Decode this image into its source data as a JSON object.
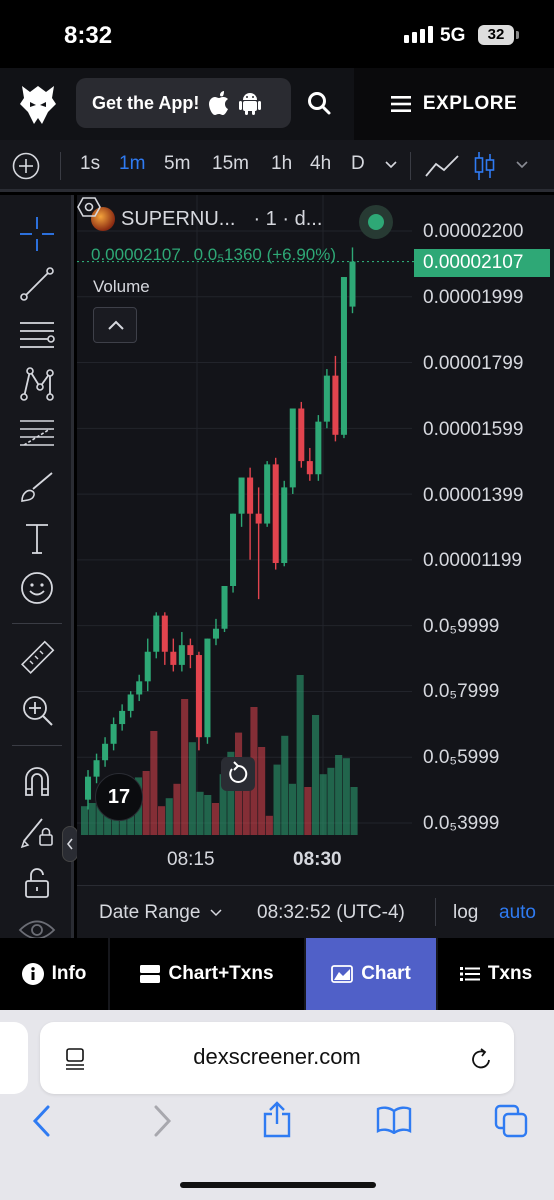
{
  "status": {
    "time": "8:32",
    "network": "5G",
    "battery": "32"
  },
  "header": {
    "get_app_label": "Get the App!",
    "explore_label": "EXPLORE"
  },
  "toolbar": {
    "timeframes": [
      {
        "label": "1s",
        "active": false
      },
      {
        "label": "1m",
        "active": true
      },
      {
        "label": "5m",
        "active": false
      },
      {
        "label": "15m",
        "active": false
      },
      {
        "label": "1h",
        "active": false
      },
      {
        "label": "4h",
        "active": false
      },
      {
        "label": "D",
        "active": false
      }
    ]
  },
  "chart": {
    "symbol": "SUPERNU...",
    "interval": "· 1 · d...",
    "last_price": "0.00002107",
    "change": "0.0₅1360 (+6.90%)",
    "volume_label": "Volume",
    "price_labels": [
      "0.00002200",
      "0.00001999",
      "0.00001799",
      "0.00001599",
      "0.00001399",
      "0.00001199",
      "0.0₅9999",
      "0.0₅7999",
      "0.0₅5999",
      "0.0₅3999"
    ],
    "price_tag": "0.00002107",
    "time_labels": [
      "08:15",
      "08:30"
    ],
    "tv_logo": "17",
    "colors": {
      "up": "#2ea876",
      "down": "#e2444e",
      "background": "#131419"
    }
  },
  "chart_data": {
    "type": "candlestick",
    "y_range": [
      3.99e-06,
      2.2e-05
    ],
    "up_color": "#2ea876",
    "down_color": "#e2444e",
    "candles": [
      {
        "o": 4.7e-06,
        "h": 5.6e-06,
        "l": 4.4e-06,
        "c": 5.4e-06
      },
      {
        "o": 5.4e-06,
        "h": 6.1e-06,
        "l": 5.2e-06,
        "c": 5.9e-06
      },
      {
        "o": 5.9e-06,
        "h": 6.6e-06,
        "l": 5.7e-06,
        "c": 6.4e-06
      },
      {
        "o": 6.4e-06,
        "h": 7.2e-06,
        "l": 6.2e-06,
        "c": 7e-06
      },
      {
        "o": 7e-06,
        "h": 7.6e-06,
        "l": 6.8e-06,
        "c": 7.4e-06
      },
      {
        "o": 7.4e-06,
        "h": 8e-06,
        "l": 7.2e-06,
        "c": 7.9e-06
      },
      {
        "o": 7.9e-06,
        "h": 8.5e-06,
        "l": 7.7e-06,
        "c": 8.3e-06
      },
      {
        "o": 8.3e-06,
        "h": 9.6e-06,
        "l": 8e-06,
        "c": 9.2e-06
      },
      {
        "o": 9.2e-06,
        "h": 1.04e-05,
        "l": 9e-06,
        "c": 1.03e-05
      },
      {
        "o": 1.03e-05,
        "h": 1.04e-05,
        "l": 8.8e-06,
        "c": 9.2e-06
      },
      {
        "o": 9.2e-06,
        "h": 9.6e-06,
        "l": 8.6e-06,
        "c": 8.8e-06
      },
      {
        "o": 8.8e-06,
        "h": 9.8e-06,
        "l": 8.6e-06,
        "c": 9.4e-06
      },
      {
        "o": 9.4e-06,
        "h": 9.6e-06,
        "l": 8.7e-06,
        "c": 9.1e-06
      },
      {
        "o": 9.1e-06,
        "h": 9.2e-06,
        "l": 6.2e-06,
        "c": 6.6e-06
      },
      {
        "o": 6.6e-06,
        "h": 9.6e-06,
        "l": 6.4e-06,
        "c": 9.6e-06
      },
      {
        "o": 9.6e-06,
        "h": 1.02e-05,
        "l": 9.4e-06,
        "c": 9.9e-06
      },
      {
        "o": 9.9e-06,
        "h": 1.12e-05,
        "l": 9.8e-06,
        "c": 1.12e-05
      },
      {
        "o": 1.12e-05,
        "h": 1.34e-05,
        "l": 1.1e-05,
        "c": 1.34e-05
      },
      {
        "o": 1.34e-05,
        "h": 1.45e-05,
        "l": 1.3e-05,
        "c": 1.45e-05
      },
      {
        "o": 1.45e-05,
        "h": 1.48e-05,
        "l": 1.2e-05,
        "c": 1.34e-05
      },
      {
        "o": 1.34e-05,
        "h": 1.42e-05,
        "l": 1.08e-05,
        "c": 1.31e-05
      },
      {
        "o": 1.31e-05,
        "h": 1.5e-05,
        "l": 1.3e-05,
        "c": 1.49e-05
      },
      {
        "o": 1.49e-05,
        "h": 1.51e-05,
        "l": 1.17e-05,
        "c": 1.19e-05
      },
      {
        "o": 1.19e-05,
        "h": 1.44e-05,
        "l": 1.18e-05,
        "c": 1.42e-05
      },
      {
        "o": 1.42e-05,
        "h": 1.66e-05,
        "l": 1.4e-05,
        "c": 1.66e-05
      },
      {
        "o": 1.66e-05,
        "h": 1.68e-05,
        "l": 1.48e-05,
        "c": 1.5e-05
      },
      {
        "o": 1.5e-05,
        "h": 1.54e-05,
        "l": 1.44e-05,
        "c": 1.46e-05
      },
      {
        "o": 1.46e-05,
        "h": 1.64e-05,
        "l": 1.44e-05,
        "c": 1.62e-05
      },
      {
        "o": 1.62e-05,
        "h": 1.78e-05,
        "l": 1.6e-05,
        "c": 1.76e-05
      },
      {
        "o": 1.76e-05,
        "h": 1.82e-05,
        "l": 1.56e-05,
        "c": 1.58e-05
      },
      {
        "o": 1.58e-05,
        "h": 2.06e-05,
        "l": 1.57e-05,
        "c": 2.06e-05
      },
      {
        "o": 1.97e-05,
        "h": 2.15e-05,
        "l": 1.95e-05,
        "c": 2.107e-05
      }
    ],
    "volume": [
      {
        "v": 18,
        "up": true
      },
      {
        "v": 20,
        "up": true
      },
      {
        "v": 24,
        "up": true
      },
      {
        "v": 22,
        "up": true
      },
      {
        "v": 20,
        "up": true
      },
      {
        "v": 19,
        "up": true
      },
      {
        "v": 27,
        "up": true
      },
      {
        "v": 36,
        "up": true
      },
      {
        "v": 40,
        "up": false
      },
      {
        "v": 65,
        "up": false
      },
      {
        "v": 18,
        "up": false
      },
      {
        "v": 23,
        "up": true
      },
      {
        "v": 32,
        "up": false
      },
      {
        "v": 85,
        "up": false
      },
      {
        "v": 58,
        "up": true
      },
      {
        "v": 27,
        "up": true
      },
      {
        "v": 25,
        "up": true
      },
      {
        "v": 20,
        "up": false
      },
      {
        "v": 38,
        "up": true
      },
      {
        "v": 52,
        "up": true
      },
      {
        "v": 64,
        "up": false
      },
      {
        "v": 38,
        "up": false
      },
      {
        "v": 80,
        "up": false
      },
      {
        "v": 55,
        "up": false
      },
      {
        "v": 12,
        "up": false
      },
      {
        "v": 44,
        "up": true
      },
      {
        "v": 62,
        "up": true
      },
      {
        "v": 32,
        "up": true
      },
      {
        "v": 100,
        "up": true
      },
      {
        "v": 30,
        "up": false
      },
      {
        "v": 75,
        "up": true
      },
      {
        "v": 38,
        "up": true
      },
      {
        "v": 42,
        "up": true
      },
      {
        "v": 50,
        "up": true
      },
      {
        "v": 48,
        "up": true
      },
      {
        "v": 30,
        "up": true
      }
    ]
  },
  "rangebar": {
    "date_range_label": "Date Range",
    "clock": "08:32:52 (UTC-4)",
    "log_label": "log",
    "auto_label": "auto"
  },
  "tabs": [
    {
      "label": "Info",
      "active": false
    },
    {
      "label": "Chart+Txns",
      "active": false
    },
    {
      "label": "Chart",
      "active": true
    },
    {
      "label": "Txns",
      "active": false
    }
  ],
  "browser": {
    "url": "dexscreener.com"
  }
}
